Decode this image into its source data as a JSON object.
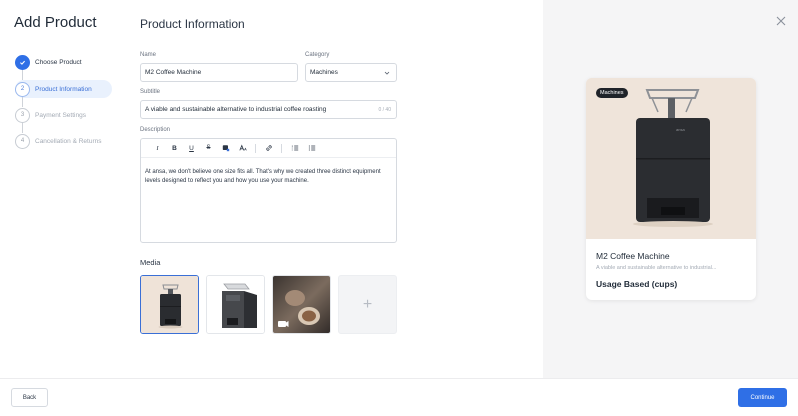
{
  "page_title": "Add Product",
  "section_title": "Product Information",
  "steps": [
    {
      "number": "1",
      "label": "Choose Product",
      "state": "done"
    },
    {
      "number": "2",
      "label": "Product Information",
      "state": "active"
    },
    {
      "number": "3",
      "label": "Payment Settings",
      "state": "todo"
    },
    {
      "number": "4",
      "label": "Cancellation & Returns",
      "state": "todo"
    }
  ],
  "form": {
    "name_label": "Name",
    "name_value": "M2 Coffee Machine",
    "category_label": "Category",
    "category_value": "Machines",
    "subtitle_label": "Subtitle",
    "subtitle_value": "A viable and sustainable alternative to industrial coffee roasting",
    "subtitle_counter": "0 / 40",
    "description_label": "Description",
    "description_value": "At ansa, we don't believe one size fits all. That's why we created three distinct equipment levels designed to reflect you and how you use your machine.",
    "toolbar": {
      "italic": "I",
      "bold": "B",
      "underline": "U",
      "strike": "S"
    }
  },
  "media": {
    "label": "Media",
    "add_symbol": "+"
  },
  "preview": {
    "badge": "Machines",
    "title": "M2 Coffee Machine",
    "subtitle": "A viable and sustainable alternative to industrial...",
    "price_model": "Usage Based (cups)"
  },
  "footer": {
    "back_label": "Back",
    "continue_label": "Continue"
  },
  "colors": {
    "accent": "#2f6fe6",
    "preview_bg": "#f5f5f6",
    "card_image_bg": "#efe4da"
  }
}
